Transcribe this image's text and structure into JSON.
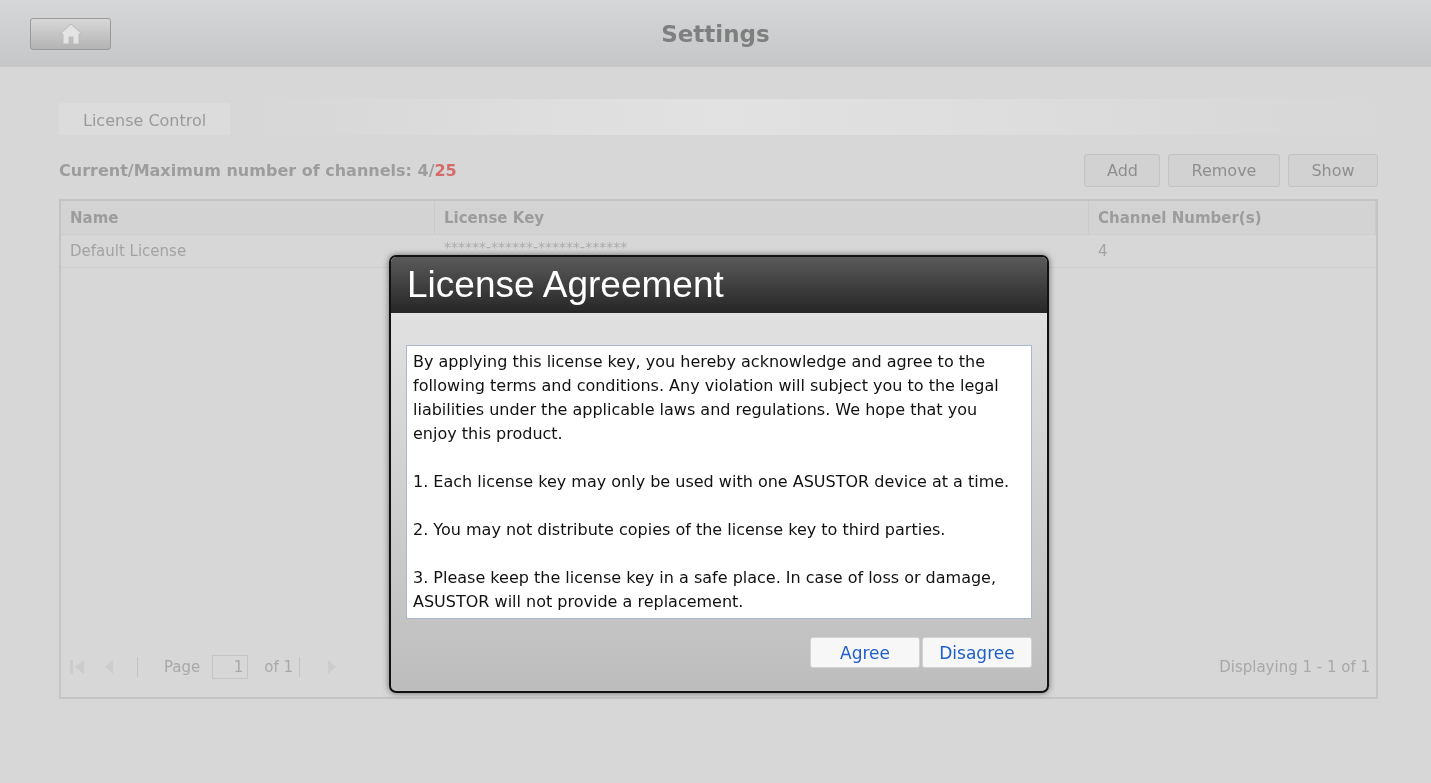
{
  "header": {
    "title": "Settings"
  },
  "tabs": [
    {
      "label": "License Control",
      "selected": true
    }
  ],
  "summary": {
    "label": "Current/Maximum number of channels: 4/",
    "maximum": "25"
  },
  "buttons": [
    "Add",
    "Remove",
    "Show"
  ],
  "table": {
    "columns": [
      "Name",
      "License Key",
      "Channel Number(s)"
    ],
    "rows": [
      [
        "Default License",
        "******-******-******-******",
        "4"
      ]
    ]
  },
  "pager": {
    "page_label": "Page",
    "page": "1",
    "of": "of 1",
    "display": "Displaying 1 - 1 of 1"
  },
  "dialog": {
    "title": "License Agreement",
    "paragraphs": [
      "By applying this license key, you hereby acknowledge and agree to the following terms and conditions. Any violation will subject you to the legal liabilities under the applicable laws and regulations. We hope that you enjoy this product.",
      "1. Each license key may only be used with one ASUSTOR device at a time.",
      "2. You may not distribute copies of the license key to third parties.",
      "3. Please keep the license key in a safe place. In case of loss or damage, ASUSTOR will not provide a replacement."
    ],
    "buttons": [
      "Agree",
      "Disagree"
    ]
  }
}
